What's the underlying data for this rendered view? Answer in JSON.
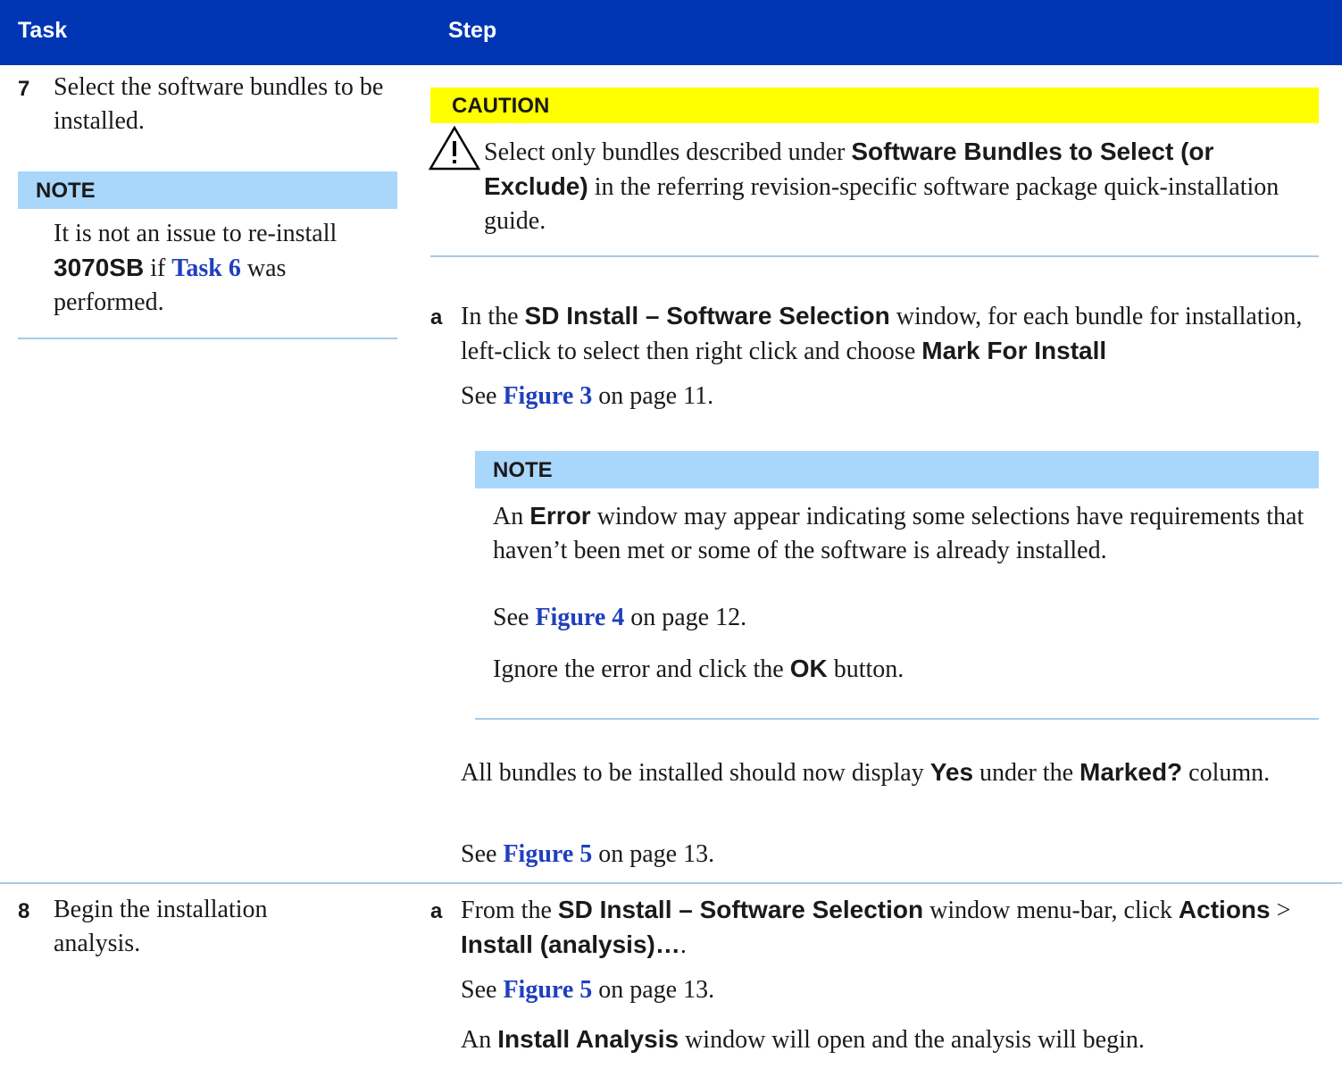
{
  "header": {
    "task": "Task",
    "step": "Step"
  },
  "task7": {
    "number": "7",
    "text": "Select the software bundles to be installed.",
    "note": {
      "label": "NOTE",
      "t1": "It is not an issue to re-install ",
      "b1": "3070SB",
      "t2": " if ",
      "link": "Task 6",
      "t3": " was performed."
    }
  },
  "caution": {
    "label": "CAUTION",
    "t1": "Select only bundles described under ",
    "b1": "Software Bundles to Select (or Exclude)",
    "t2": " in the referring revision-specific software package quick-installation guide."
  },
  "step7a": {
    "letter": "a",
    "t1": "In the ",
    "b1": "SD Install – Software Selection",
    "t2": " window, for each bundle for installation, left-click to select then right click and choose ",
    "b2": "Mark For Install",
    "see1": "See ",
    "fig": "Figure 3",
    "see2": " on page 11."
  },
  "note2": {
    "label": "NOTE",
    "t1": "An ",
    "b1": "Error",
    "t2": " window may appear indicating some selections have requirements that haven’t been met or some of the software is already installed.",
    "see1": "See ",
    "fig": "Figure 4",
    "see2": " on page 12.",
    "ig1": "Ignore the error and click the ",
    "ig_b": "OK",
    "ig2": " button."
  },
  "after": {
    "t1": "All bundles to be installed should now display ",
    "b1": "Yes",
    "t2": " under the ",
    "b2": "Marked?",
    "t3": " column.",
    "see1": "See ",
    "fig": "Figure 5",
    "see2": " on page 13."
  },
  "task8": {
    "number": "8",
    "text": "Begin the installation analysis."
  },
  "step8a": {
    "letter": "a",
    "t1": "From the ",
    "b1": "SD Install – Software Selection",
    "t2": " window menu-bar, click ",
    "b2": "Actions",
    "t3": " > ",
    "b3": "Install (analysis)…",
    "t4": ".",
    "see1": "See ",
    "fig": "Figure 5",
    "see2": " on page 13.",
    "r1": "An ",
    "rb": "Install Analysis",
    "r2": " window will open and the analysis will begin."
  }
}
